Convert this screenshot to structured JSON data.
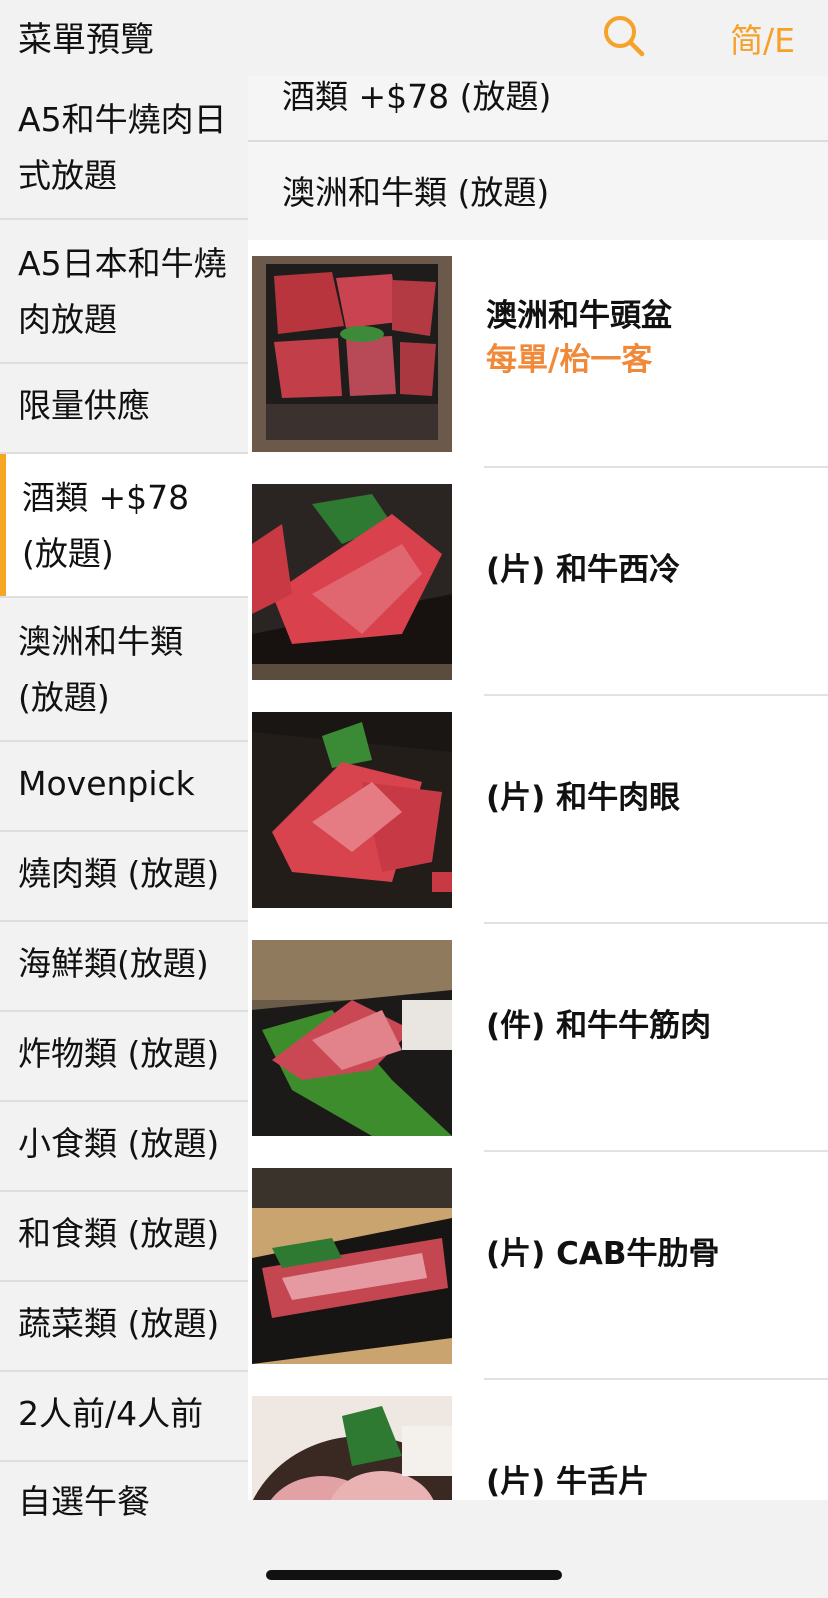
{
  "header": {
    "title": "菜單預覽",
    "lang_toggle": "简/E",
    "search_icon": "search-icon"
  },
  "colors": {
    "accent": "#f5a12a",
    "note": "#f08a3a",
    "active_bar": "#f5a623"
  },
  "sidebar": {
    "items": [
      {
        "label": "A5和牛燒肉日式放題",
        "active": false
      },
      {
        "label": "A5日本和牛燒肉放題",
        "active": false
      },
      {
        "label": "限量供應",
        "active": false
      },
      {
        "label": "酒類 +$78 (放題)",
        "active": true
      },
      {
        "label": "澳洲和牛類 (放題)",
        "active": false
      },
      {
        "label": "Movenpick",
        "active": false
      },
      {
        "label": "燒肉類 (放題)",
        "active": false
      },
      {
        "label": "海鮮類(放題)",
        "active": false
      },
      {
        "label": "炸物類 (放題)",
        "active": false
      },
      {
        "label": "小食類 (放題)",
        "active": false
      },
      {
        "label": "和食類 (放題)",
        "active": false
      },
      {
        "label": "蔬菜類 (放題)",
        "active": false
      },
      {
        "label": "2人前/4人前",
        "active": false
      },
      {
        "label": "自選午餐",
        "active": false
      }
    ]
  },
  "main": {
    "categories": [
      {
        "label": "酒類 +$78 (放題)"
      },
      {
        "label": "澳洲和牛類 (放題)"
      }
    ],
    "items": [
      {
        "name": "澳洲和牛頭盆",
        "note": "每單/枱一客"
      },
      {
        "name": "(片) 和牛西冷"
      },
      {
        "name": "(片) 和牛肉眼"
      },
      {
        "name": "(件) 和牛牛筋肉"
      },
      {
        "name": "(片) CAB牛肋骨"
      },
      {
        "name": "(片) 牛舌片"
      }
    ]
  }
}
